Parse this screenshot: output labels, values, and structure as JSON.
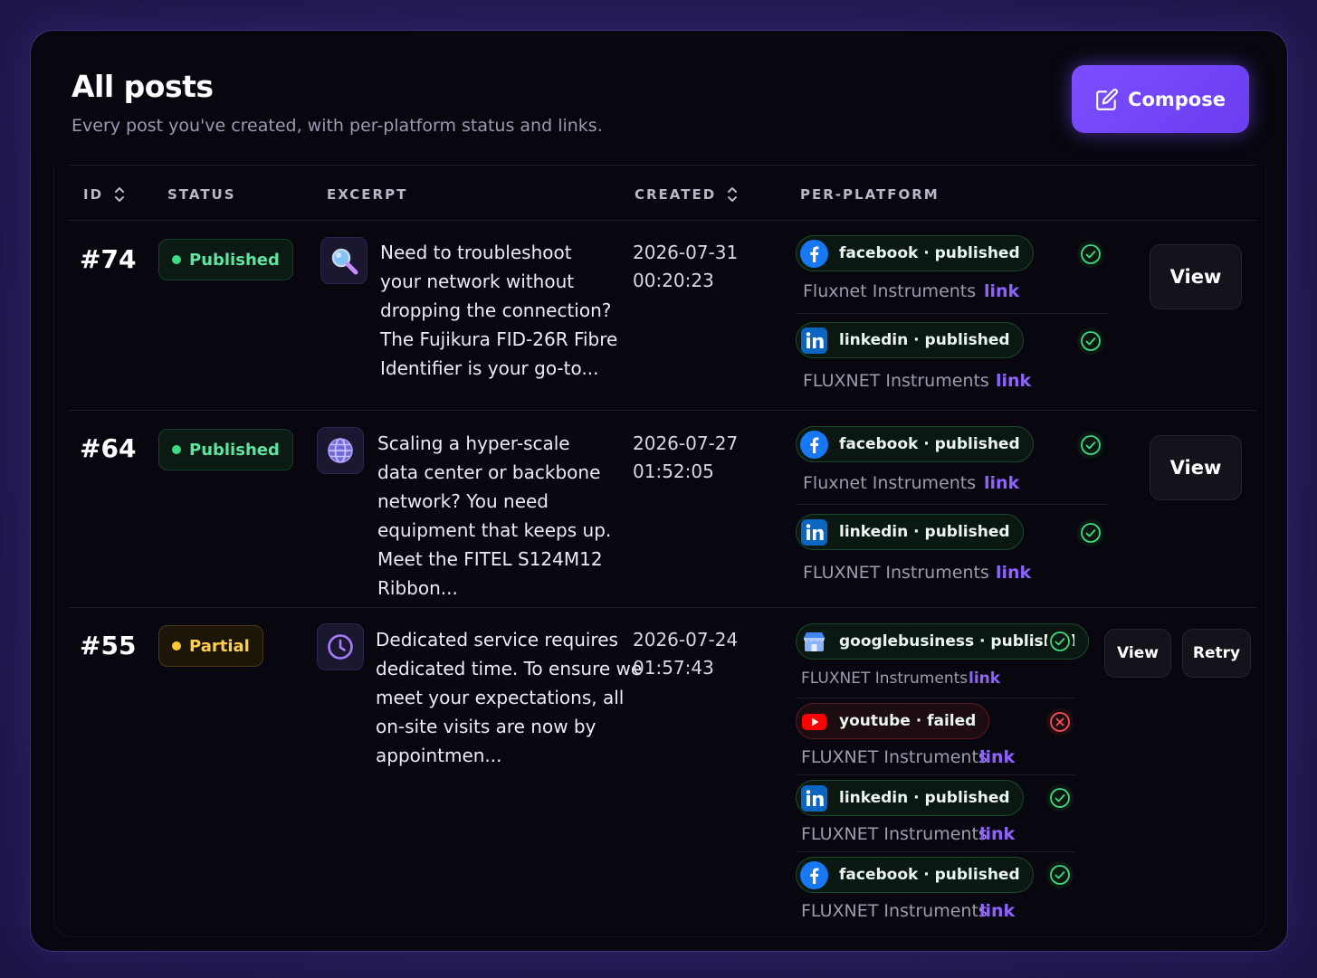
{
  "header": {
    "title": "All posts",
    "subtitle": "Every post you've created, with per-platform status and links.",
    "compose_label": "Compose"
  },
  "columns": {
    "id": "ID",
    "status": "STATUS",
    "excerpt": "EXCERPT",
    "created": "CREATED",
    "per_platform": "PER-PLATFORM"
  },
  "posts": [
    {
      "id": "#74",
      "status": "Published",
      "thumb_icon": "magnifier-icon",
      "excerpt_lines": [
        "Need to troubleshoot",
        "your network without",
        "dropping the connection?",
        "The Fujikura FID-26R Fibre",
        "Identifier is your go-to..."
      ],
      "created_date": "2026-07-31",
      "created_time": "00:20:23",
      "platforms": [
        {
          "chip": "facebook · published",
          "account": "Fluxnet Instruments",
          "link": "link",
          "state": "published"
        },
        {
          "chip": "linkedin · published",
          "account": "FLUXNET Instruments",
          "link": "link",
          "state": "published"
        }
      ],
      "actions": {
        "view": "View"
      }
    },
    {
      "id": "#64",
      "status": "Published",
      "thumb_icon": "globe-icon",
      "excerpt_lines": [
        "Scaling a hyper-scale",
        "data center or backbone",
        "network? You need",
        "equipment that keeps up.",
        "Meet the FITEL S124M12",
        "Ribbon..."
      ],
      "created_date": "2026-07-27",
      "created_time": "01:52:05",
      "platforms": [
        {
          "chip": "facebook · published",
          "account": "Fluxnet Instruments",
          "link": "link",
          "state": "published"
        },
        {
          "chip": "linkedin · published",
          "account": "FLUXNET Instruments",
          "link": "link",
          "state": "published"
        }
      ],
      "actions": {
        "view": "View"
      }
    },
    {
      "id": "#55",
      "status": "Partial",
      "thumb_icon": "clock-icon",
      "excerpt_lines": [
        "Dedicated service requires",
        "dedicated time. To ensure we",
        "meet your expectations, all",
        "on-site visits are now by",
        "appointmen..."
      ],
      "created_date": "2026-07-24",
      "created_time": "01:57:43",
      "platforms": [
        {
          "chip": "googlebusiness · published",
          "account": "FLUXNET Instruments",
          "link": "link",
          "state": "published"
        },
        {
          "chip": "youtube · failed",
          "account": "FLUXNET Instruments",
          "link": "link",
          "state": "failed"
        },
        {
          "chip": "linkedin · published",
          "account": "FLUXNET Instruments",
          "link": "link",
          "state": "published"
        },
        {
          "chip": "facebook · published",
          "account": "FLUXNET Instruments",
          "link": "link",
          "state": "published"
        }
      ],
      "actions": {
        "view": "View",
        "retry": "Retry"
      }
    }
  ],
  "colors": {
    "accent": "#7b4dff",
    "published": "#3ddc84",
    "partial": "#ffc933",
    "failed": "#ff4d5e",
    "link": "#8f63ff"
  }
}
